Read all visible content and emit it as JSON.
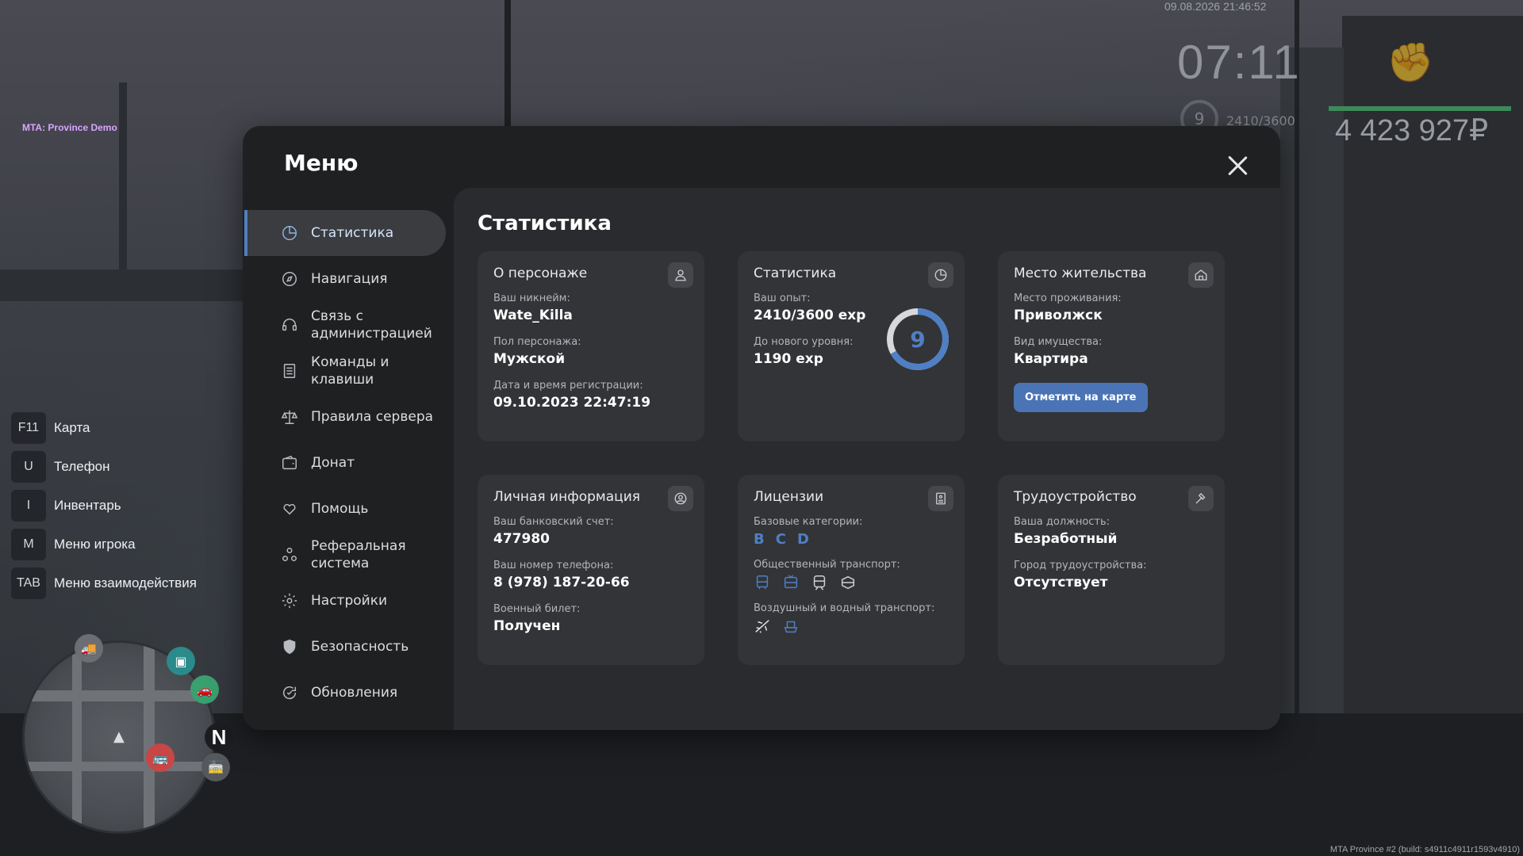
{
  "game": {
    "server_label": "MTA: Province Demo",
    "build_info": "MTA Province #2 (build: s4911c4911r1593v4910)"
  },
  "hud": {
    "datetime": "09.08.2026 21:46:52",
    "time": "07:11",
    "level": "9",
    "exp": "2410/3600",
    "money": "4 423 927₽"
  },
  "hotkeys": [
    {
      "key": "F11",
      "label": "Карта"
    },
    {
      "key": "U",
      "label": "Телефон"
    },
    {
      "key": "I",
      "label": "Инвентарь"
    },
    {
      "key": "M",
      "label": "Меню игрока"
    },
    {
      "key": "TAB",
      "label": "Меню взаимодействия"
    }
  ],
  "minimap": {
    "north": "N"
  },
  "menu": {
    "title": "Меню",
    "nav": [
      {
        "label": "Статистика",
        "icon": "pie-chart-icon"
      },
      {
        "label": "Навигация",
        "icon": "compass-icon"
      },
      {
        "label": "Связь с администрацией",
        "icon": "headset-icon"
      },
      {
        "label": "Команды и клавиши",
        "icon": "document-icon"
      },
      {
        "label": "Правила сервера",
        "icon": "scales-icon"
      },
      {
        "label": "Донат",
        "icon": "wallet-icon"
      },
      {
        "label": "Помощь",
        "icon": "heart-hand-icon"
      },
      {
        "label": "Реферальная система",
        "icon": "people-icon"
      },
      {
        "label": "Настройки",
        "icon": "gear-icon"
      },
      {
        "label": "Безопасность",
        "icon": "shield-icon"
      },
      {
        "label": "Обновления",
        "icon": "refresh-icon"
      }
    ],
    "active_index": 0
  },
  "stats": {
    "title": "Статистика",
    "character": {
      "title": "О персонаже",
      "nickname_label": "Ваш никнейм:",
      "nickname": "Wate_Killa",
      "gender_label": "Пол персонажа:",
      "gender": "Мужской",
      "reg_label": "Дата и время регистрации:",
      "reg_date": "09.10.2023 22:47:19"
    },
    "statistics": {
      "title": "Статистика",
      "exp_label": "Ваш опыт:",
      "exp": "2410/3600 exp",
      "next_label": "До нового уровня:",
      "next": "1190 exp",
      "level": "9",
      "progress": 0.67
    },
    "residence": {
      "title": "Место жительства",
      "place_label": "Место проживания:",
      "place": "Приволжск",
      "property_label": "Вид имущества:",
      "property": "Квартира",
      "map_button": "Отметить на карте"
    },
    "personal": {
      "title": "Личная информация",
      "bank_label": "Ваш банковский счет:",
      "bank": "477980",
      "phone_label": "Ваш номер телефона:",
      "phone": "8 (978) 187-20-66",
      "military_label": "Военный билет:",
      "military": "Получен"
    },
    "licenses": {
      "title": "Лицензии",
      "base_label": "Базовые категории:",
      "categories": [
        "B",
        "C",
        "D"
      ],
      "public_label": "Общественный транспорт:",
      "air_label": "Воздушный и водный транспорт:"
    },
    "employment": {
      "title": "Трудоустройство",
      "position_label": "Ваша должность:",
      "position": "Безработный",
      "city_label": "Город трудоустройства:",
      "city": "Отсутствует"
    }
  },
  "colors": {
    "accent": "#4f7fc4",
    "button": "#4a74b5",
    "panel": "#1f2022",
    "card": "#323437"
  }
}
